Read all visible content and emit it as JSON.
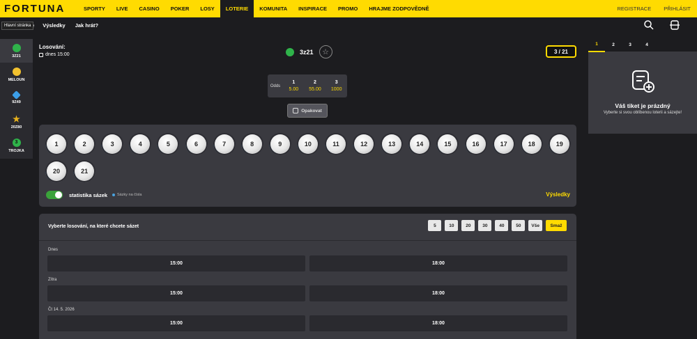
{
  "header": {
    "logo": "FORTUNA",
    "nav": [
      "SPORTY",
      "LIVE",
      "CASINO",
      "POKER",
      "LOSY",
      "LOTERIE",
      "KOMUNITA",
      "INSPIRACE",
      "PROMO",
      "HRAJME ZODPOVĚDNĚ"
    ],
    "active": "LOTERIE",
    "register": "REGISTRACE",
    "login": "PŘIHLÁSIT"
  },
  "subnav": {
    "home_tooltip": "Hlavní stránka",
    "first_link_fragment": "rie",
    "results": "Výsledky",
    "how_to_play": "Jak hrát?"
  },
  "leftnav": [
    {
      "label": "3Z21",
      "icon": "clover-icon",
      "color": "#2fb34a"
    },
    {
      "label": "MELOUN",
      "icon": "melon-icon",
      "color": "#f2c12e"
    },
    {
      "label": "9Z49",
      "icon": "diamond-icon",
      "color": "#3c9ee8"
    },
    {
      "label": "20Z80",
      "icon": "star-icon",
      "color": "#e8b21c"
    },
    {
      "label": "TROJKA",
      "icon": "three-icon",
      "color": "#2fb34a"
    }
  ],
  "draw": {
    "label": "Losování:",
    "time": "dnes 15:00",
    "game": "3z21",
    "counter": "3 / 21"
  },
  "odds": {
    "label": "Odds",
    "cols": [
      {
        "n": "1",
        "v": "5.00"
      },
      {
        "n": "2",
        "v": "55.00"
      },
      {
        "n": "3",
        "v": "1000"
      }
    ]
  },
  "repeat_label": "Opakovat",
  "balls": [
    "1",
    "2",
    "3",
    "4",
    "5",
    "6",
    "7",
    "8",
    "9",
    "10",
    "11",
    "12",
    "13",
    "14",
    "15",
    "16",
    "17",
    "18",
    "19",
    "20",
    "21"
  ],
  "stats": {
    "label": "statistika sázek",
    "legend": "Sázky na čísla",
    "results_link": "Výsledky"
  },
  "draw_select": {
    "title": "Vyberte losování, na které chcete sázet",
    "filters": [
      "5",
      "10",
      "20",
      "30",
      "40",
      "50",
      "Vše",
      "Smaž"
    ],
    "days": [
      {
        "label": "Dnes",
        "slots": [
          "15:00",
          "18:00"
        ]
      },
      {
        "label": "Zítra",
        "slots": [
          "15:00",
          "18:00"
        ]
      },
      {
        "label": "Čt 14. 5. 2026",
        "slots": [
          "15:00",
          "18:00"
        ]
      }
    ]
  },
  "ticket": {
    "tabs": [
      "1",
      "2",
      "3",
      "4"
    ],
    "empty_title": "Váš tiket je prázdný",
    "empty_sub": "Vyberte si svou oblíbenou loterii a sázejte!"
  },
  "colors": {
    "brand": "#ffdb01",
    "background": "#1c1c1f",
    "panel": "#3a3a40",
    "accent_blue": "#4aa3df"
  }
}
